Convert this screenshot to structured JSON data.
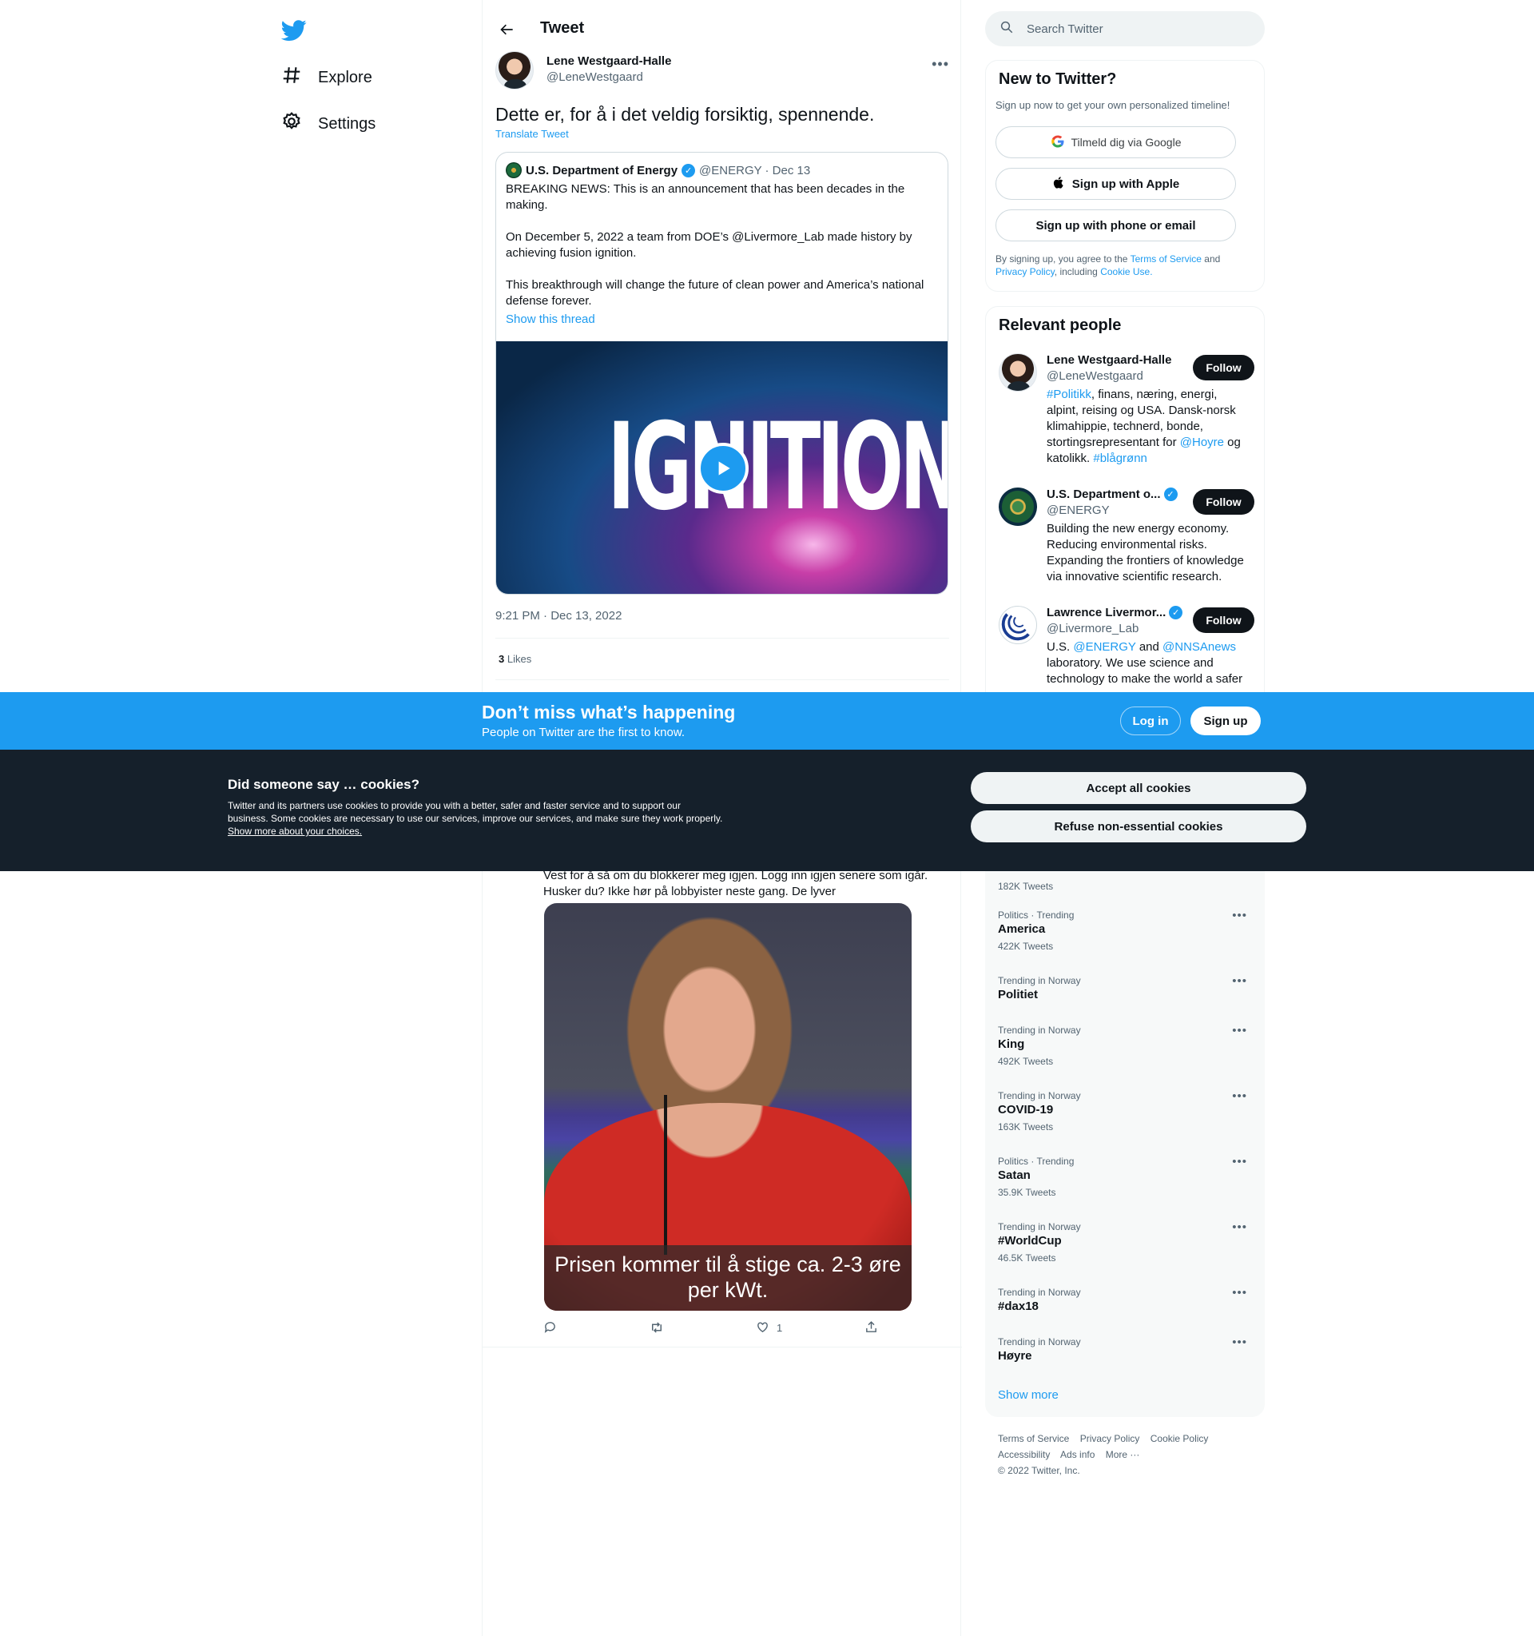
{
  "nav": {
    "explore": "Explore",
    "settings": "Settings"
  },
  "header": {
    "title": "Tweet"
  },
  "tweet": {
    "author_name": "Lene Westgaard-Halle",
    "author_handle": "@LeneWestgaard",
    "text": "Dette er, for å i det veldig forsiktig, spennende.",
    "translate": "Translate Tweet",
    "timestamp": "9:21 PM · Dec 13, 2022",
    "likes_count": "3",
    "likes_label": "Likes",
    "quote": {
      "name": "U.S. Department of Energy",
      "handle_date": "@ENERGY · Dec 13",
      "p1": "BREAKING NEWS: This is an announcement that has been decades in the making.",
      "p2": "On December 5, 2022 a team from DOE’s @Livermore_Lab made history by achieving fusion ignition.",
      "p3": "This breakthrough will change the future of clean power and America’s national defense forever.",
      "show_thread": "Show this thread",
      "media_word": "IGNITION"
    }
  },
  "reply": {
    "text_line1": "Vest for å så om du blokkerer meg igjen. Logg inn igjen senere som igår.",
    "text_line2": "Husker du? Ikke hør på lobbyister neste gang. De lyver",
    "caption": "Prisen kommer til å stige ca. 2-3 øre per kWt.",
    "like_count": "1"
  },
  "search": {
    "placeholder": "Search Twitter"
  },
  "new_to_twitter": {
    "title": "New to Twitter?",
    "subtitle": "Sign up now to get your own personalized timeline!",
    "google": "Tilmeld dig via Google",
    "apple": "Sign up with Apple",
    "phone": "Sign up with phone or email",
    "legal_pre": "By signing up, you agree to the",
    "terms": "Terms of Service",
    "and": "and",
    "privacy": "Privacy Policy",
    "including": ", including",
    "cookie": "Cookie Use."
  },
  "relevant": {
    "title": "Relevant people",
    "follow": "Follow",
    "people": [
      {
        "name": "Lene Westgaard-Halle",
        "handle": "@LeneWestgaard"
      },
      {
        "name": "U.S. Department o...",
        "handle": "@ENERGY",
        "bio": "Building the new energy economy. Reducing environmental risks. Expanding the frontiers of knowledge via innovative scientific research."
      },
      {
        "name": "Lawrence Livermor...",
        "handle": "@Livermore_Lab"
      }
    ],
    "bio1": {
      "a": "#Politikk",
      "b": ", finans, næring, energi, alpint, reising og USA. Dansk-norsk klimahippie, technerd, bonde, stortingsrepresentant for ",
      "c": "@Hoyre",
      "d": " og katolikk. ",
      "e": "#blågrønn"
    },
    "bio3": {
      "a": "U.S. ",
      "b": "@ENERGY",
      "c": " and ",
      "d": "@NNSAnews",
      "e": " laboratory. We use science and technology to make the world a safer"
    }
  },
  "trends": [
    {
      "context": "",
      "title": "",
      "count": "182K Tweets"
    },
    {
      "context": "Politics · Trending",
      "title": "America",
      "count": "422K Tweets"
    },
    {
      "context": "Trending in Norway",
      "title": "Politiet",
      "count": ""
    },
    {
      "context": "Trending in Norway",
      "title": "King",
      "count": "492K Tweets"
    },
    {
      "context": "Trending in Norway",
      "title": "COVID-19",
      "count": "163K Tweets"
    },
    {
      "context": "Politics · Trending",
      "title": "Satan",
      "count": "35.9K Tweets"
    },
    {
      "context": "Trending in Norway",
      "title": "#WorldCup",
      "count": "46.5K Tweets"
    },
    {
      "context": "Trending in Norway",
      "title": "#dax18",
      "count": ""
    },
    {
      "context": "Trending in Norway",
      "title": "Høyre",
      "count": ""
    }
  ],
  "show_more": "Show more",
  "footer": {
    "terms": "Terms of Service",
    "privacy": "Privacy Policy",
    "cookie": "Cookie Policy",
    "accessibility": "Accessibility",
    "ads": "Ads info",
    "more": "More ···",
    "copyright": "© 2022 Twitter, Inc."
  },
  "banner": {
    "headline": "Don’t miss what’s happening",
    "sub": "People on Twitter are the first to know.",
    "login": "Log in",
    "signup": "Sign up"
  },
  "cookies": {
    "title": "Did someone say … cookies?",
    "body": "Twitter and its partners use cookies to provide you with a better, safer and faster service and to support our business. Some cookies are necessary to use our services, improve our services, and make sure they work properly.",
    "link": "Show more about your choices.",
    "accept": "Accept all cookies",
    "refuse": "Refuse non-essential cookies"
  },
  "colors": {
    "accent": "#1d9bf0",
    "text": "#0f1419",
    "muted": "#536471",
    "cookie_bg": "#15202b"
  }
}
